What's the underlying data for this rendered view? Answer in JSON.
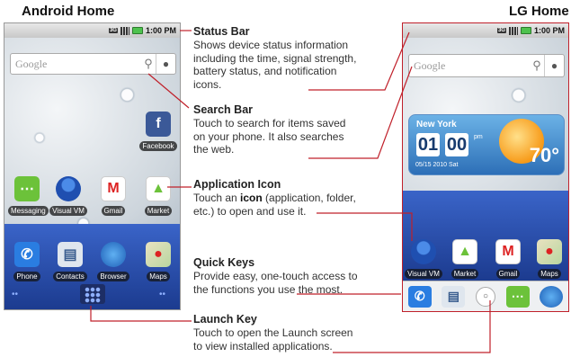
{
  "titles": {
    "left": "Android Home",
    "right": "LG Home"
  },
  "android": {
    "status_time": "1:00 PM",
    "status_3g": "3G",
    "search_placeholder": "Google",
    "apps": [
      {
        "label": "Facebook"
      },
      {
        "label": "Messaging"
      },
      {
        "label": "Visual VM"
      },
      {
        "label": "Gmail"
      },
      {
        "label": "Market"
      },
      {
        "label": "Phone"
      },
      {
        "label": "Contacts"
      },
      {
        "label": "Browser"
      },
      {
        "label": "Maps"
      }
    ]
  },
  "lg": {
    "status_time": "1:00 PM",
    "status_3g": "3G",
    "search_placeholder": "Google",
    "weather": {
      "city": "New York",
      "hour": "01",
      "minute": "00",
      "ampm": "pm",
      "date": "05/15 2010 Sat",
      "temp": "70°"
    },
    "apps": [
      {
        "label": "Visual VM"
      },
      {
        "label": "Market"
      },
      {
        "label": "Gmail"
      },
      {
        "label": "Maps"
      }
    ]
  },
  "annotations": {
    "status_bar": {
      "title": "Status Bar",
      "body": [
        "Shows device status information",
        "including the time, signal strength,",
        "battery status, and notification",
        "icons."
      ]
    },
    "search_bar": {
      "title": "Search Bar",
      "body": [
        "Touch to search for items saved",
        "on your phone. It also searches",
        "the web."
      ]
    },
    "app_icon": {
      "title": "Application Icon",
      "body_pre": "Touch an ",
      "body_bold": "icon",
      "body_post": " (application, folder,",
      "body_line2": "etc.) to open and use it."
    },
    "quick_keys": {
      "title": "Quick Keys",
      "body": [
        "Provide easy, one-touch access to",
        "the functions you use the most."
      ]
    },
    "launch_key": {
      "title": "Launch Key",
      "body": [
        "Touch to open the Launch screen",
        "to view installed applications."
      ]
    }
  },
  "colors": {
    "leader_line": "#c0202a",
    "lg_frame": "#c0202a"
  }
}
